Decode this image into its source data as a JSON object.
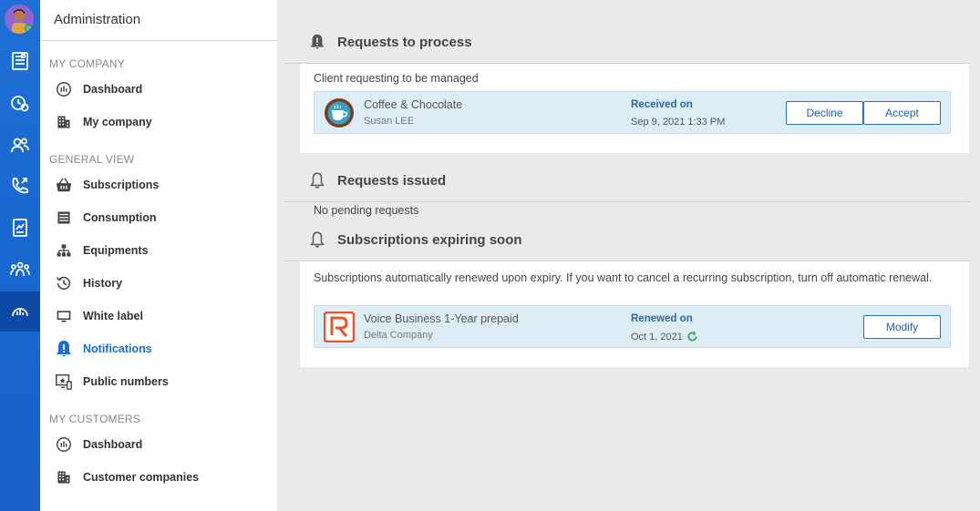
{
  "sidebar": {
    "title": "Administration",
    "sections": [
      {
        "label": "MY COMPANY",
        "items": [
          {
            "label": "Dashboard",
            "icon": "dashboard-icon"
          },
          {
            "label": "My company",
            "icon": "building-icon"
          }
        ]
      },
      {
        "label": "GENERAL VIEW",
        "items": [
          {
            "label": "Subscriptions",
            "icon": "basket-icon"
          },
          {
            "label": "Consumption",
            "icon": "list-icon"
          },
          {
            "label": "Equipments",
            "icon": "hierarchy-icon"
          },
          {
            "label": "History",
            "icon": "history-icon"
          },
          {
            "label": "White label",
            "icon": "monitor-icon"
          },
          {
            "label": "Notifications",
            "icon": "bell-alert-icon",
            "active": true
          },
          {
            "label": "Public numbers",
            "icon": "public-numbers-icon"
          }
        ]
      },
      {
        "label": "MY CUSTOMERS",
        "items": [
          {
            "label": "Dashboard",
            "icon": "dashboard-icon"
          },
          {
            "label": "Customer companies",
            "icon": "building-icon"
          }
        ]
      }
    ]
  },
  "rail": {
    "icons": [
      "directory-icon",
      "clock-icon",
      "users-icon",
      "phone-icon",
      "report-icon",
      "groups-icon",
      "admin-dashboard-icon"
    ],
    "active": "admin-dashboard-icon"
  },
  "main": {
    "requests_to_process": {
      "title": "Requests to process",
      "description": "Client requesting to be managed",
      "item": {
        "name": "Coffee & Chocolate",
        "contact": "Susan LEE",
        "status_label": "Received on",
        "status_value": "Sep 9, 2021 1:33 PM",
        "decline_label": "Decline",
        "accept_label": "Accept"
      }
    },
    "requests_issued": {
      "title": "Requests issued",
      "empty_text": "No pending requests"
    },
    "subscriptions_expiring": {
      "title": "Subscriptions expiring soon",
      "description": "Subscriptions automatically renewed upon expiry. If you want to cancel a recurring subscription, turn off automatic renewal.",
      "item": {
        "name": "Voice Business 1-Year prepaid",
        "company": "Delta Company",
        "status_label": "Renewed on",
        "status_value": "Oct 1, 2021",
        "modify_label": "Modify"
      }
    }
  },
  "colors": {
    "accent": "#1a6fd1",
    "rail": "#1e6fd6",
    "card": "#ddedf6"
  }
}
